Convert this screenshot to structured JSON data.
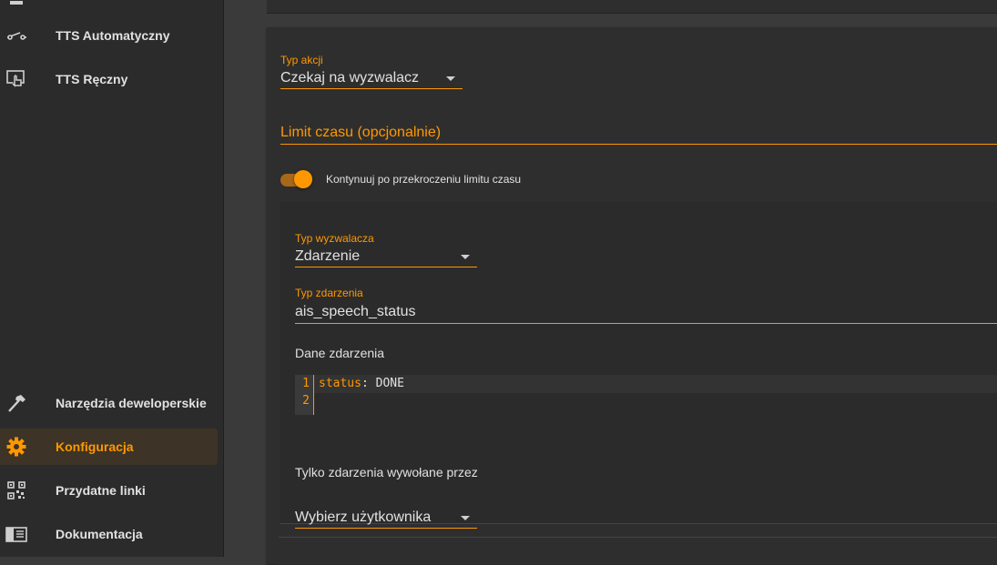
{
  "sidebar": {
    "items": [
      {
        "label": "TTS Automatyczny",
        "icon": "toggle-switch-icon"
      },
      {
        "label": "TTS Ręczny",
        "icon": "touch-screen-icon"
      },
      {
        "label": "Narzędzia deweloperskie",
        "icon": "hammer-icon"
      },
      {
        "label": "Konfiguracja",
        "icon": "gear-icon",
        "active": true
      },
      {
        "label": "Przydatne linki",
        "icon": "qr-code-icon"
      },
      {
        "label": "Dokumentacja",
        "icon": "book-icon"
      }
    ]
  },
  "action": {
    "type_label": "Typ akcji",
    "type_value": "Czekaj na wyzwalacz",
    "limit_label": "Limit czasu (opcjonalnie)",
    "continue_toggle_label": "Kontynuuj po przekroczeniu limitu czasu",
    "continue_toggle_on": true
  },
  "trigger": {
    "type_label": "Typ wyzwalacza",
    "type_value": "Zdarzenie",
    "event_type_label": "Typ zdarzenia",
    "event_type_value": "ais_speech_status",
    "event_data_label": "Dane zdarzenia",
    "code_lines": [
      "1",
      "2"
    ],
    "code_key": "status",
    "code_sep": ": ",
    "code_value": "DONE",
    "only_events_label": "Tylko zdarzenia wywołane przez",
    "user_select_value": "Wybierz użytkownika"
  },
  "colors": {
    "accent": "#ff9800",
    "background": "#3a3a3a",
    "sidebar": "#2b2b2b",
    "card": "#2e2e2e"
  }
}
